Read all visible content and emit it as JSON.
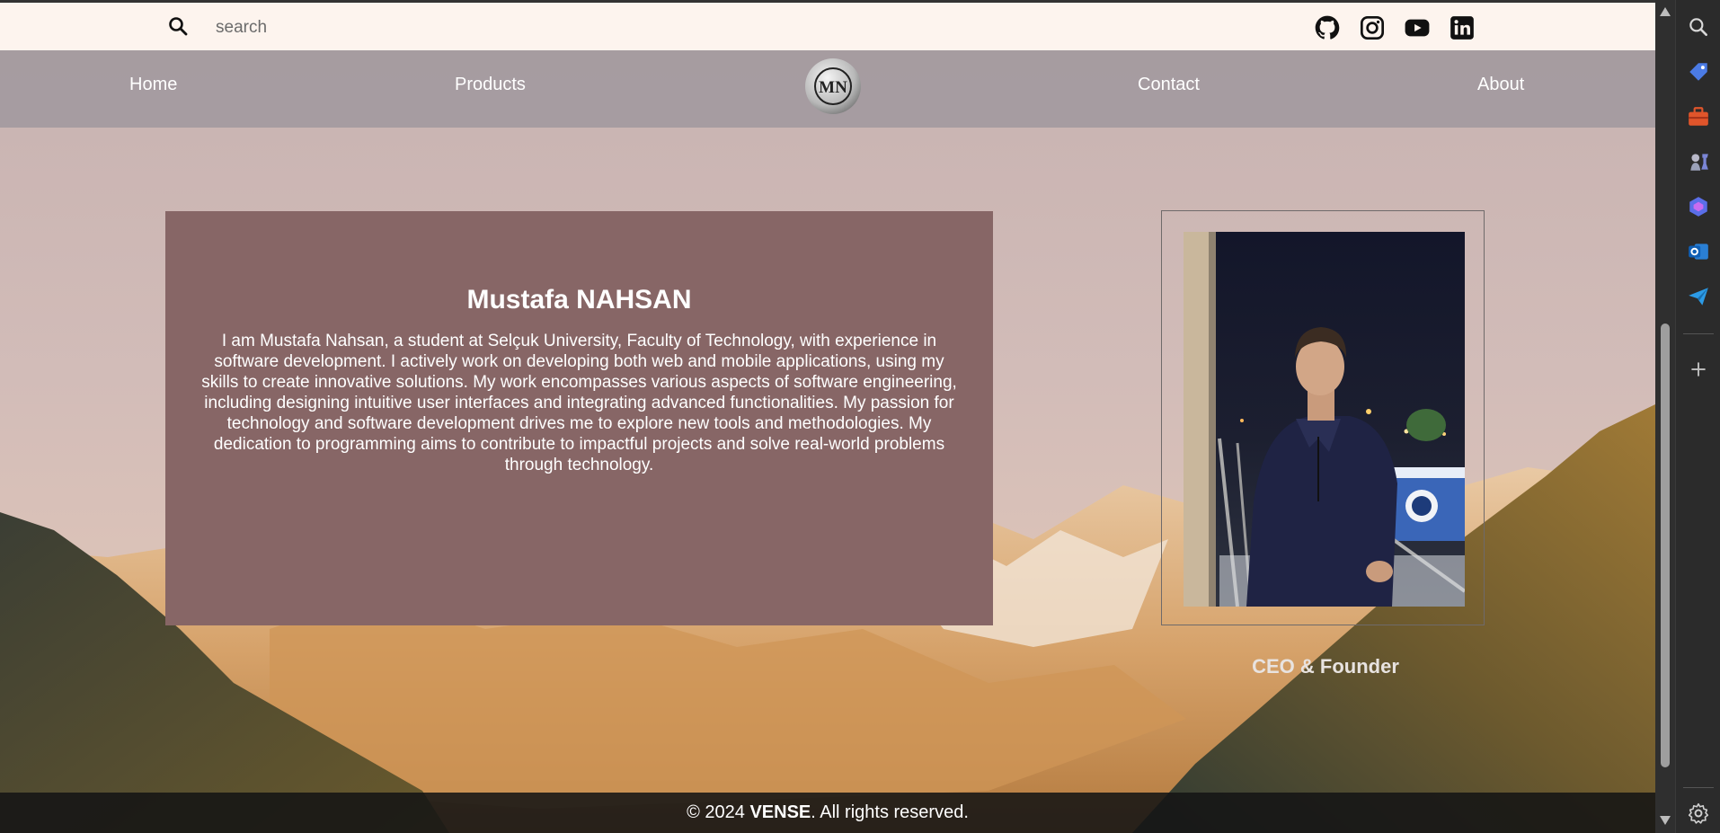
{
  "search": {
    "placeholder": "search"
  },
  "social": [
    "github-icon",
    "instagram-icon",
    "youtube-icon",
    "linkedin-icon"
  ],
  "nav": {
    "home": "Home",
    "products": "Products",
    "logo_text": "MN",
    "contact": "Contact",
    "about": "About"
  },
  "profile": {
    "name": "Mustafa NAHSAN",
    "bio": "I am Mustafa Nahsan, a student at Selçuk University, Faculty of Technology, with experience in software development. I actively work on developing both web and mobile applications, using my skills to create innovative solutions. My work encompasses various aspects of software engineering, including designing intuitive user interfaces and integrating advanced functionalities. My passion for technology and software development drives me to explore new tools and methodologies. My dedication to programming aims to contribute to impactful projects and solve real-world problems through technology.",
    "role": "CEO & Founder"
  },
  "footer": {
    "prefix": "© 2024 ",
    "brand": "VENSE",
    "suffix": ". All rights reserved."
  },
  "colors": {
    "topbar_bg": "#fdf4ee",
    "nav_bg": "#a0989e",
    "card_bg": "#876666",
    "footer_bg": "#141414"
  },
  "sidebar": [
    "search-icon",
    "tag-icon",
    "briefcase-icon",
    "chess-icon",
    "copilot-icon",
    "outlook-icon",
    "send-icon",
    "add-icon",
    "settings-icon"
  ]
}
